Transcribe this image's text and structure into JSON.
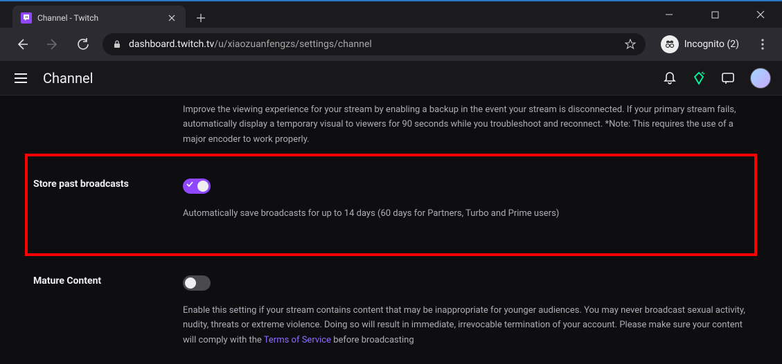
{
  "browser": {
    "tab_title": "Channel - Twitch",
    "url_host": "dashboard.twitch.tv",
    "url_path": "/u/xiaozuanfengzs/settings/channel",
    "incognito_label": "Incognito (2)"
  },
  "appbar": {
    "page_title": "Channel"
  },
  "settings": {
    "disconnect": {
      "description": "Improve the viewing experience for your stream by enabling a backup in the event your stream is disconnected. If your primary stream fails, automatically display a temporary visual to viewers for 90 seconds while you troubleshoot and reconnect. *Note: This requires the use of a major encoder to work properly."
    },
    "store_past_broadcasts": {
      "label": "Store past broadcasts",
      "toggle_state": "on",
      "description": "Automatically save broadcasts for up to 14 days (60 days for Partners, Turbo and Prime users)"
    },
    "mature_content": {
      "label": "Mature Content",
      "toggle_state": "off",
      "description_pre": "Enable this setting if your stream contains content that may be inappropriate for younger audiences. You may never broadcast sexual activity, nudity, threats or extreme violence. Doing so will result in immediate, irrevocable termination of your account. Please make sure your content will comply with the ",
      "tos_link_text": "Terms of Service",
      "description_post": " before broadcasting"
    }
  }
}
